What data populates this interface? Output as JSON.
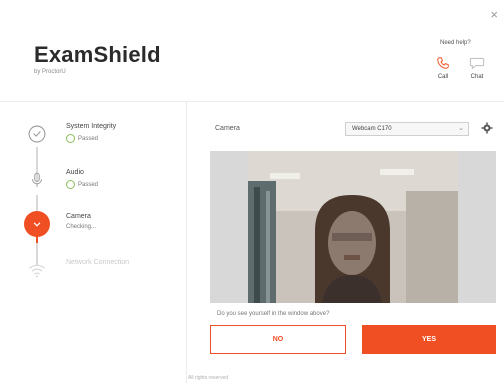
{
  "window": {
    "close_glyph": "×"
  },
  "brand": {
    "title": "ExamShield",
    "subtitle": "by ProctorU"
  },
  "help": {
    "title": "Need help?",
    "call_label": "Call",
    "chat_label": "Chat",
    "call_icon": "phone-icon",
    "chat_icon": "chat-icon"
  },
  "steps": [
    {
      "title": "System Integrity",
      "status": "Passed",
      "state": "passed",
      "icon": "shield-icon"
    },
    {
      "title": "Audio",
      "status": "Passed",
      "state": "passed",
      "icon": "microphone-icon"
    },
    {
      "title": "Camera",
      "status": "Checking...",
      "state": "active",
      "icon": "camera-icon"
    },
    {
      "title": "Network Connection",
      "status": "",
      "state": "pending",
      "icon": "wifi-icon"
    }
  ],
  "camera": {
    "label": "Camera",
    "selected_device": "Webcam C170",
    "question": "Do you see yourself in the window above?"
  },
  "buttons": {
    "no_label": "NO",
    "yes_label": "YES"
  },
  "footer": {
    "text": "All rights reserved"
  },
  "colors": {
    "accent": "#f04e23",
    "passed": "#8bbf5a",
    "divider": "#ececec"
  }
}
